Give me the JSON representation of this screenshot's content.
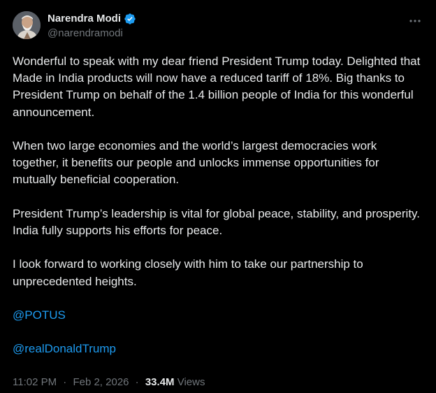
{
  "author": {
    "display_name": "Narendra Modi",
    "handle": "@narendramodi",
    "verified": true,
    "verified_color": "#1d9bf0"
  },
  "paragraphs": [
    "Wonderful to speak with my dear friend President Trump today. Delighted that Made in India products will now have a reduced tariff of 18%. Big thanks to President Trump on behalf of the 1.4 billion people of India for this wonderful announcement.",
    "When two large economies and the world’s largest democracies work together, it benefits our people and unlocks immense opportunities for mutually beneficial cooperation.",
    "President Trump’s leadership is vital for global peace, stability, and prosperity. India fully supports his efforts for peace.",
    "I look forward to working closely with him to take our partnership to unprecedented heights."
  ],
  "mentions": [
    "@POTUS",
    "@realDonaldTrump"
  ],
  "meta": {
    "time": "11:02 PM",
    "separator": "·",
    "date": "Feb 2, 2026",
    "views_count": "33.4M",
    "views_label": "Views"
  },
  "icons": {
    "verified": "verified-badge-icon",
    "more": "more-options-icon"
  },
  "colors": {
    "background": "#000000",
    "text": "#e7e9ea",
    "secondary_text": "#71767b",
    "link": "#1d9bf0"
  }
}
